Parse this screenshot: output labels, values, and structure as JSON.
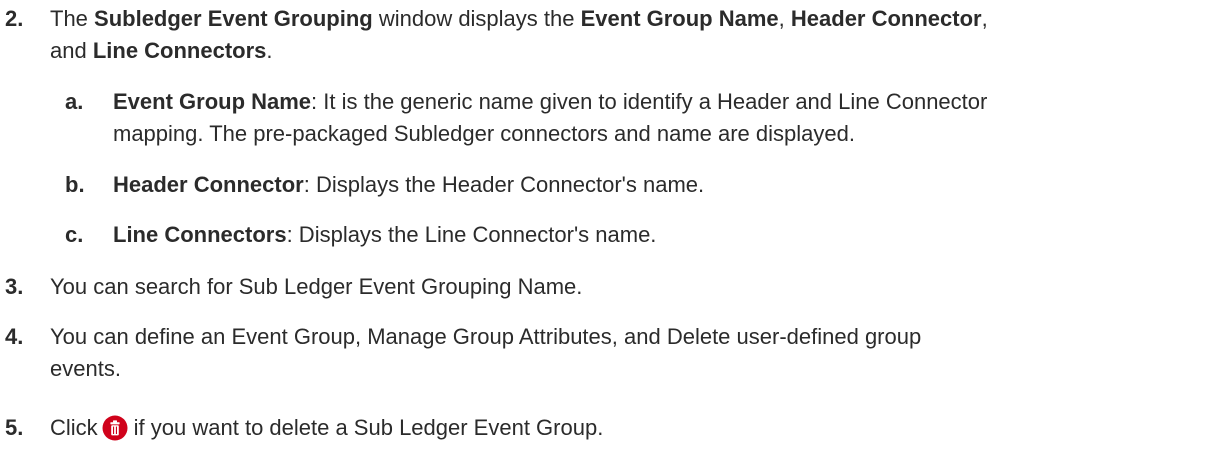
{
  "steps": {
    "s2": {
      "num": "2.",
      "t1": "The ",
      "b1": "Subledger Event Grouping",
      "t2": " window displays the ",
      "b2": "Event Group Name",
      "t3": ", ",
      "b3": "Header Connector",
      "t4": ",",
      "t5": "and ",
      "b4": "Line Connectors",
      "t6": "."
    },
    "sa": {
      "letter": "a.",
      "b": "Event Group Name",
      "t1": ": It is the generic name given to identify a Header and Line Connector",
      "t2": "mapping. The pre-packaged Subledger connectors and name are displayed."
    },
    "sb": {
      "letter": "b.",
      "b": "Header Connector",
      "t": ": Displays the Header Connector's name."
    },
    "sc": {
      "letter": "c.",
      "b": "Line Connectors",
      "t": ": Displays the Line Connector's name."
    },
    "s3": {
      "num": "3.",
      "t": "You can search for Sub Ledger Event Grouping Name."
    },
    "s4": {
      "num": "4.",
      "t1": "You can define an Event Group, Manage Group Attributes, and Delete user-defined group",
      "t2": "events."
    },
    "s5": {
      "num": "5.",
      "t1": "Click",
      "t2": "if you want to delete a Sub Ledger Event Group."
    }
  },
  "icons": {
    "delete": "delete-icon"
  },
  "colors": {
    "delete_icon": "#d0021b",
    "text": "#2b2b2b"
  }
}
